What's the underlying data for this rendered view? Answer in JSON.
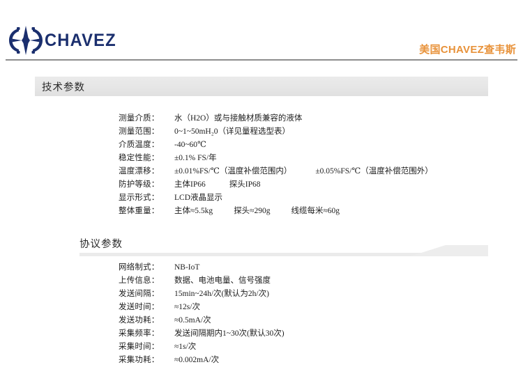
{
  "header": {
    "logo_word": "CHAVEZ",
    "logo_mark_name": "chavez-star-gear-emblem",
    "brand_cn": "美国CHAVEZ查韦斯",
    "brand_color": "#e8923a",
    "logo_color": "#1b2f6e"
  },
  "sections": [
    {
      "title": "技术参数",
      "rows": [
        {
          "label": "测量介质：",
          "parts": [
            "水（H2O）或与接触材质兼容的液体"
          ]
        },
        {
          "label": "测量范围：",
          "parts": [
            "0~1~50mH₂0（详见量程选型表）"
          ]
        },
        {
          "label": "介质温度：",
          "parts": [
            "-40~60℃"
          ]
        },
        {
          "label": "稳定性能：",
          "parts": [
            "±0.1% FS/年"
          ]
        },
        {
          "label": "温度漂移：",
          "parts": [
            "±0.01%FS/℃（温度补偿范围内）",
            "±0.05%FS/℃（温度补偿范围外）"
          ]
        },
        {
          "label": "防护等级：",
          "parts": [
            "主体IP66",
            "探头IP68"
          ]
        },
        {
          "label": "显示形式：",
          "parts": [
            "LCD液晶显示"
          ]
        },
        {
          "label": "整体重量：",
          "parts": [
            "主体≈5.5kg",
            "探头≈290g",
            "线缆每米≈60g"
          ]
        }
      ]
    },
    {
      "title": "协议参数",
      "rows": [
        {
          "label": "网络制式：",
          "parts": [
            "NB-IoT"
          ]
        },
        {
          "label": "上传信息：",
          "parts": [
            "数据、电池电量、信号强度"
          ]
        },
        {
          "label": "发送间隔：",
          "parts": [
            "15min~24h/次(默认为2h/次)"
          ]
        },
        {
          "label": "发送时间：",
          "parts": [
            "≈12s/次"
          ]
        },
        {
          "label": "发送功耗：",
          "parts": [
            "≈0.5mA/次"
          ]
        },
        {
          "label": "采集频率：",
          "parts": [
            "发送间隔期内1~30次(默认30次)"
          ]
        },
        {
          "label": "采集时间：",
          "parts": [
            "≈1s/次"
          ]
        },
        {
          "label": "采集功耗：",
          "parts": [
            "≈0.002mA/次"
          ]
        }
      ]
    }
  ]
}
